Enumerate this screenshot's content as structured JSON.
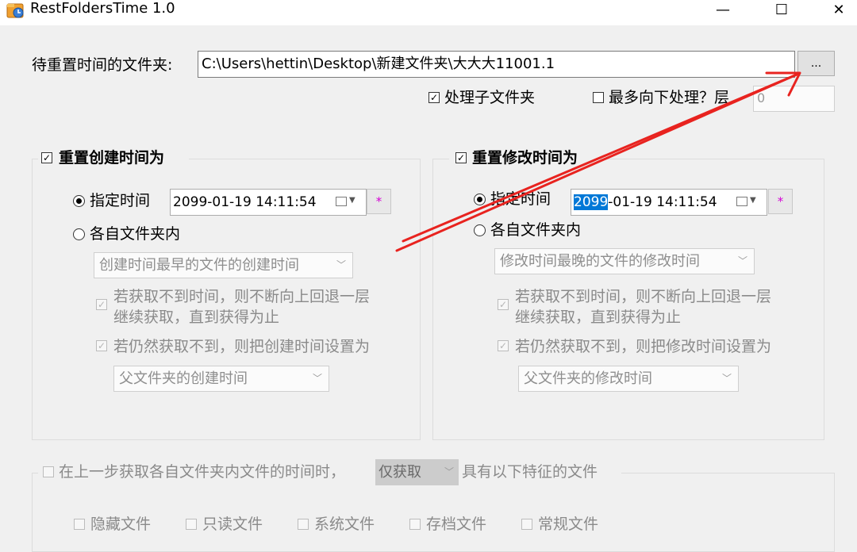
{
  "window": {
    "title": "RestFoldersTime 1.0",
    "minimize": "—",
    "maximize": "☐",
    "close": "✕"
  },
  "folder": {
    "label": "待重置时间的文件夹:",
    "path": "C:\\Users\\hettin\\Desktop\\新建文件夹\\大大大11001.1",
    "browse": "...",
    "process_subfolders": "处理子文件夹",
    "max_depth_label": "最多向下处理？层",
    "max_depth_value": "0"
  },
  "create_group": {
    "title": "重置创建时间为",
    "specified_time": "指定时间",
    "datetime": "2099-01-19 14:11:54",
    "star": "*",
    "per_folder": "各自文件夹内",
    "source_option": "创建时间最早的文件的创建时间",
    "fallback_line1": "若获取不到时间，则不断向上回退一层",
    "fallback_line2": "继续获取，直到获得为止",
    "still_fail": "若仍然获取不到，则把创建时间设置为",
    "parent_option": "父文件夹的创建时间"
  },
  "modify_group": {
    "title": "重置修改时间为",
    "specified_time": "指定时间",
    "datetime_selected": "2099",
    "datetime_rest": "-01-19 14:11:54",
    "star": "*",
    "per_folder": "各自文件夹内",
    "source_option": "修改时间最晚的文件的修改时间",
    "fallback_line1": "若获取不到时间，则不断向上回退一层",
    "fallback_line2": "继续获取，直到获得为止",
    "still_fail": "若仍然获取不到，则把修改时间设置为",
    "parent_option": "父文件夹的修改时间"
  },
  "filter": {
    "prefix": "在上一步获取各自文件夹内文件的时间时，",
    "mode": "仅获取",
    "suffix": "具有以下特征的文件",
    "attributes": [
      "隐藏文件",
      "只读文件",
      "系统文件",
      "存档文件",
      "常规文件"
    ]
  },
  "colors": {
    "annotation_arrow": "#e8231f",
    "selection": "#0078d7",
    "star": "#d400d4"
  }
}
